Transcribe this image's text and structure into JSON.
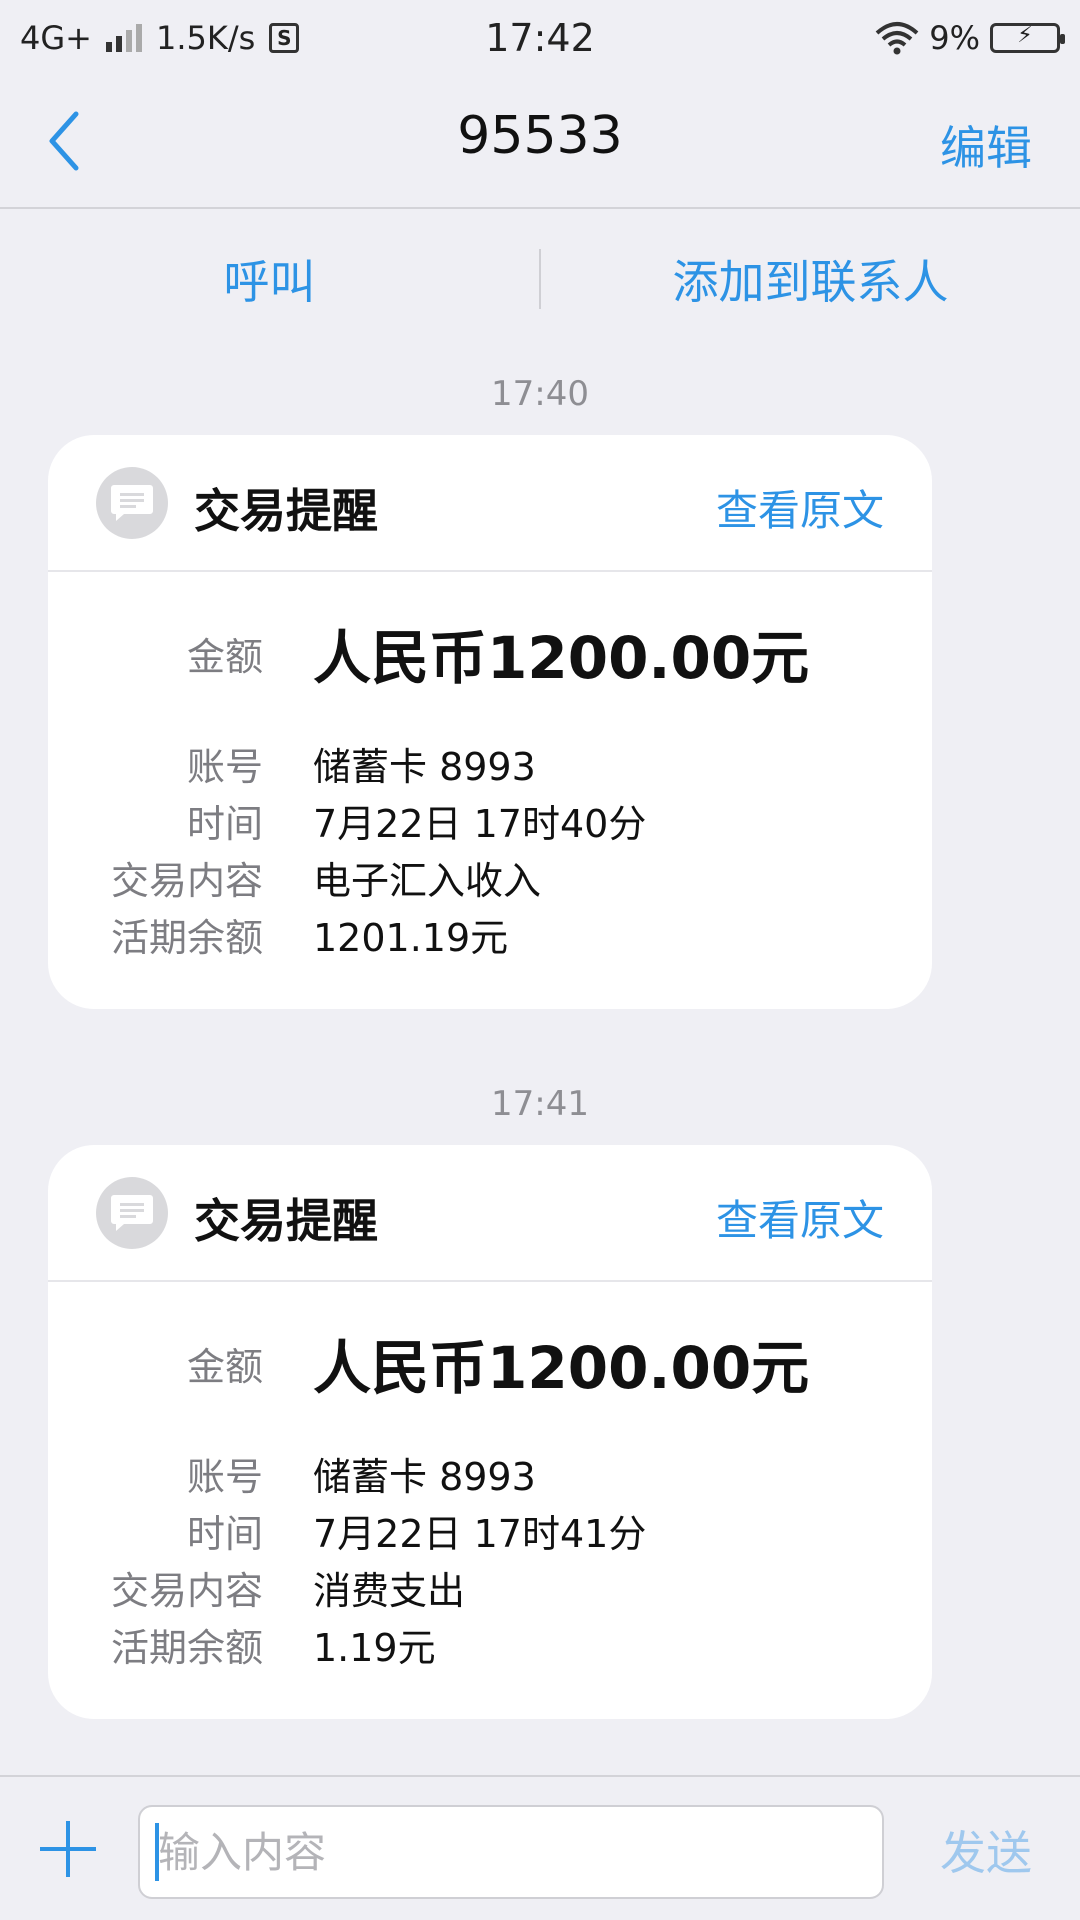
{
  "status_bar": {
    "network": "4G+",
    "speed": "1.5K/s",
    "time": "17:42",
    "battery": "9%"
  },
  "nav": {
    "title": "95533",
    "edit_label": "编辑"
  },
  "actions": {
    "call_label": "呼叫",
    "add_contact_label": "添加到联系人"
  },
  "messages": [
    {
      "timestamp": "17:40",
      "title": "交易提醒",
      "view_label": "查看原文",
      "amount_label": "金额",
      "amount": "人民币1200.00元",
      "account_label": "账号",
      "account": "储蓄卡 8993",
      "time_label": "时间",
      "time": "7月22日 17时40分",
      "content_label": "交易内容",
      "content": "电子汇入收入",
      "balance_label": "活期余额",
      "balance": "1201.19元"
    },
    {
      "timestamp": "17:41",
      "title": "交易提醒",
      "view_label": "查看原文",
      "amount_label": "金额",
      "amount": "人民币1200.00元",
      "account_label": "账号",
      "account": "储蓄卡 8993",
      "time_label": "时间",
      "time": "7月22日 17时41分",
      "content_label": "交易内容",
      "content": "消费支出",
      "balance_label": "活期余额",
      "balance": "1.19元"
    }
  ],
  "composer": {
    "placeholder": "输入内容",
    "value": "",
    "send_label": "发送"
  },
  "colors": {
    "accent": "#2d93e5",
    "background": "#efeff4",
    "card": "#ffffff"
  }
}
